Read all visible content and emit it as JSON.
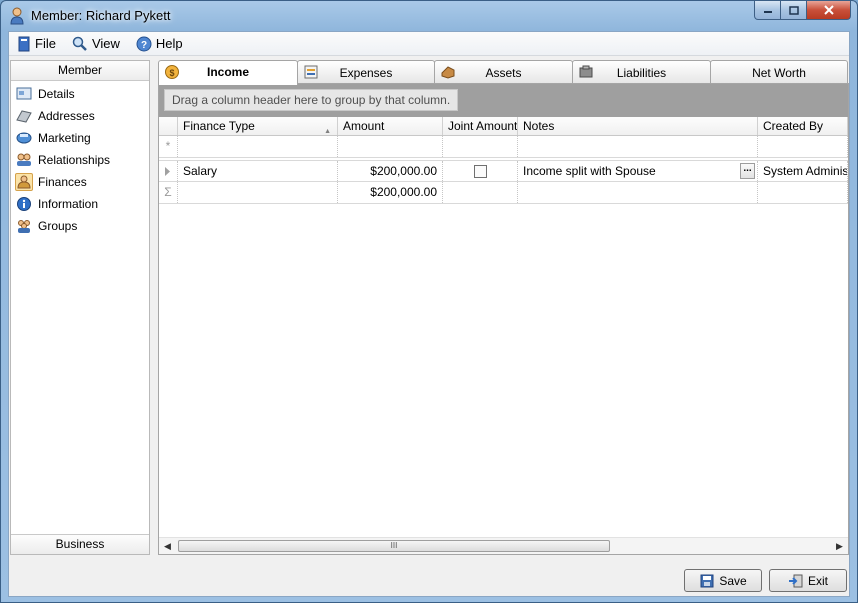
{
  "window": {
    "title": "Member: Richard Pykett"
  },
  "menu": [
    {
      "label": "File",
      "icon": "file-icon"
    },
    {
      "label": "View",
      "icon": "view-icon"
    },
    {
      "label": "Help",
      "icon": "help-icon"
    }
  ],
  "sidebar": {
    "header": "Member",
    "footer": "Business",
    "items": [
      {
        "label": "Details",
        "icon": "details-icon"
      },
      {
        "label": "Addresses",
        "icon": "addresses-icon"
      },
      {
        "label": "Marketing",
        "icon": "marketing-icon"
      },
      {
        "label": "Relationships",
        "icon": "relationships-icon"
      },
      {
        "label": "Finances",
        "icon": "finances-icon",
        "selected": true
      },
      {
        "label": "Information",
        "icon": "information-icon"
      },
      {
        "label": "Groups",
        "icon": "groups-icon"
      }
    ]
  },
  "tabs": [
    {
      "label": "Income",
      "icon": "income-icon",
      "active": true
    },
    {
      "label": "Expenses",
      "icon": "expenses-icon"
    },
    {
      "label": "Assets",
      "icon": "assets-icon"
    },
    {
      "label": "Liabilities",
      "icon": "liabilities-icon"
    },
    {
      "label": "Net Worth"
    }
  ],
  "grid": {
    "group_hint": "Drag a column header here to group by that column.",
    "columns": [
      "Finance Type",
      "Amount",
      "Joint Amount",
      "Notes",
      "Created By"
    ],
    "new_row_marker": "*",
    "rows": [
      {
        "finance_type": "Salary",
        "amount": "$200,000.00",
        "joint": false,
        "notes": "Income split with Spouse",
        "notes_button": "...",
        "created_by": "System Administr..."
      }
    ],
    "summary_marker": "Σ",
    "total_amount": "$200,000.00",
    "scroll_grip": "III"
  },
  "buttons": {
    "save": "Save",
    "exit": "Exit"
  },
  "colors": {
    "accent": "#3a5f86",
    "selected_item": "#fbe3a8",
    "group_area": "#9f9f9f"
  }
}
